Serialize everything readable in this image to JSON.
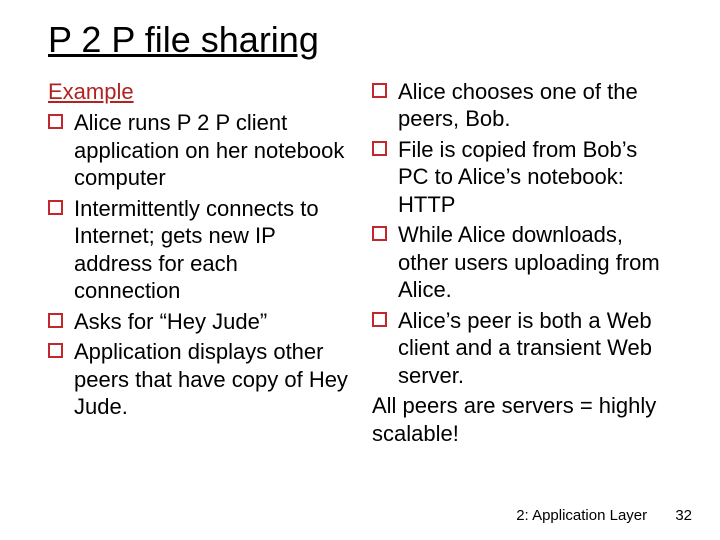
{
  "title": "P 2 P file sharing",
  "left": {
    "subhead": "Example",
    "bullets": [
      "Alice runs P 2 P client application on her notebook computer",
      "Intermittently connects to Internet; gets new IP address for each connection",
      "Asks for “Hey Jude”",
      "Application displays other peers that have copy of Hey Jude."
    ]
  },
  "right": {
    "bullets": [
      "Alice chooses one of the peers, Bob.",
      "File is copied from Bob’s PC to Alice’s notebook: HTTP",
      "While Alice downloads, other users uploading from Alice.",
      "Alice’s peer is both a Web client and a transient Web server."
    ],
    "closing": "All peers are servers = highly scalable!"
  },
  "footer": {
    "chapter": "2: Application Layer",
    "page": "32"
  }
}
